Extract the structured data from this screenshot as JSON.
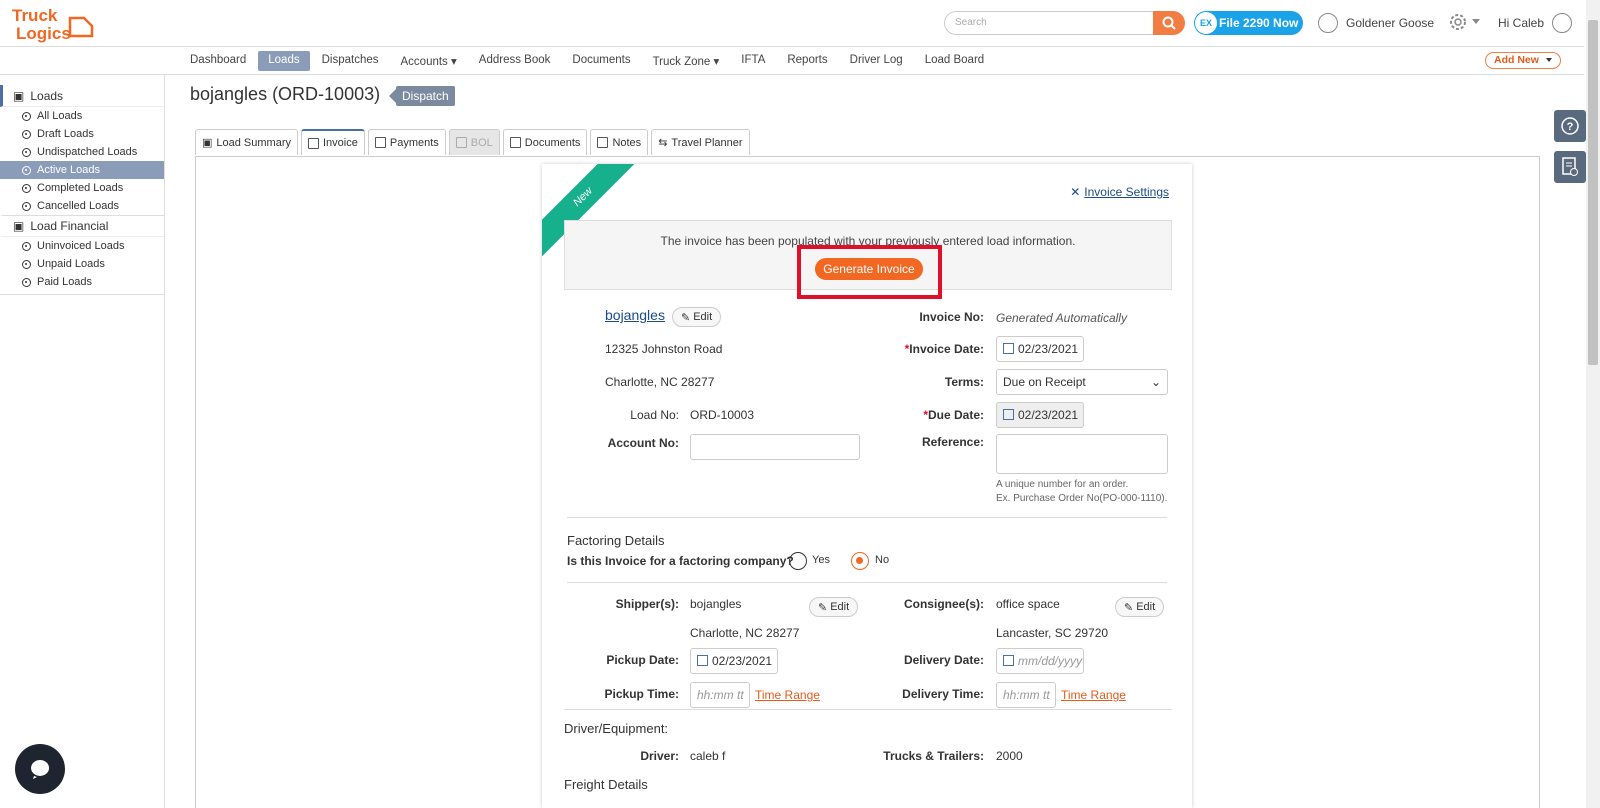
{
  "brand": {
    "name": "TruckLogics",
    "accent": "#f26722",
    "blue": "#1aa3e8"
  },
  "header": {
    "search_placeholder": "Search",
    "file2290_label": "File 2290 Now",
    "file2290_badge": "EX",
    "company_name": "Goldener Goose",
    "greeting": "Hi Caleb"
  },
  "nav": {
    "items": [
      "Dashboard",
      "Loads",
      "Dispatches",
      "Accounts",
      "Address Book",
      "Documents",
      "Truck Zone",
      "IFTA",
      "Reports",
      "Driver Log",
      "Load Board"
    ],
    "active": "Loads",
    "add_new_label": "Add New"
  },
  "sidebar": {
    "loads_label": "Loads",
    "loads_items": [
      "All Loads",
      "Draft Loads",
      "Undispatched Loads",
      "Active Loads",
      "Completed Loads",
      "Cancelled Loads"
    ],
    "active_item": "Active Loads",
    "financial_label": "Load Financial",
    "financial_items": [
      "Uninvoiced Loads",
      "Unpaid Loads",
      "Paid Loads"
    ]
  },
  "page": {
    "title": "bojangles (ORD-10003)",
    "status_badge": "Dispatch"
  },
  "tabs": [
    "Load Summary",
    "Invoice",
    "Payments",
    "BOL",
    "Documents",
    "Notes",
    "Travel Planner"
  ],
  "invoice": {
    "ribbon": "New",
    "settings_link": "Invoice Settings",
    "notice_text": "The invoice has been populated with your previously entered load information.",
    "generate_button": "Generate Invoice",
    "customer_name": "bojangles",
    "edit_label": "Edit",
    "address_line1": "12325 Johnston Road",
    "address_line2": "Charlotte, NC 28277",
    "load_no_label": "Load No:",
    "load_no_value": "ORD-10003",
    "account_no_label": "Account No:",
    "invoice_no_label": "Invoice No:",
    "invoice_no_value": "Generated Automatically",
    "invoice_date_label": "Invoice Date:",
    "invoice_date_value": "02/23/2021",
    "terms_label": "Terms:",
    "terms_value": "Due on Receipt",
    "due_date_label": "Due Date:",
    "due_date_value": "02/23/2021",
    "reference_label": "Reference:",
    "reference_hint1": "A unique number for an order.",
    "reference_hint2": "Ex. Purchase Order No(PO-000-1110).",
    "factoring_title": "Factoring Details",
    "factoring_question": "Is this Invoice for a factoring company?",
    "yes_label": "Yes",
    "no_label": "No",
    "factoring_selected": "No",
    "shipper_label": "Shipper(s):",
    "shipper_name": "bojangles",
    "shipper_city": "Charlotte, NC 28277",
    "consignee_label": "Consignee(s):",
    "consignee_name": "office space",
    "consignee_city": "Lancaster, SC 29720",
    "pickup_date_label": "Pickup Date:",
    "pickup_date_value": "02/23/2021",
    "delivery_date_label": "Delivery Date:",
    "delivery_date_placeholder": "mm/dd/yyyy",
    "pickup_time_label": "Pickup Time:",
    "delivery_time_label": "Delivery Time:",
    "time_placeholder": "hh:mm tt",
    "time_range_label": "Time Range",
    "driver_section": "Driver/Equipment:",
    "driver_label": "Driver:",
    "driver_value": "caleb f",
    "trucks_label": "Trucks & Trailers:",
    "trucks_value": "2000",
    "freight_section": "Freight Details"
  }
}
